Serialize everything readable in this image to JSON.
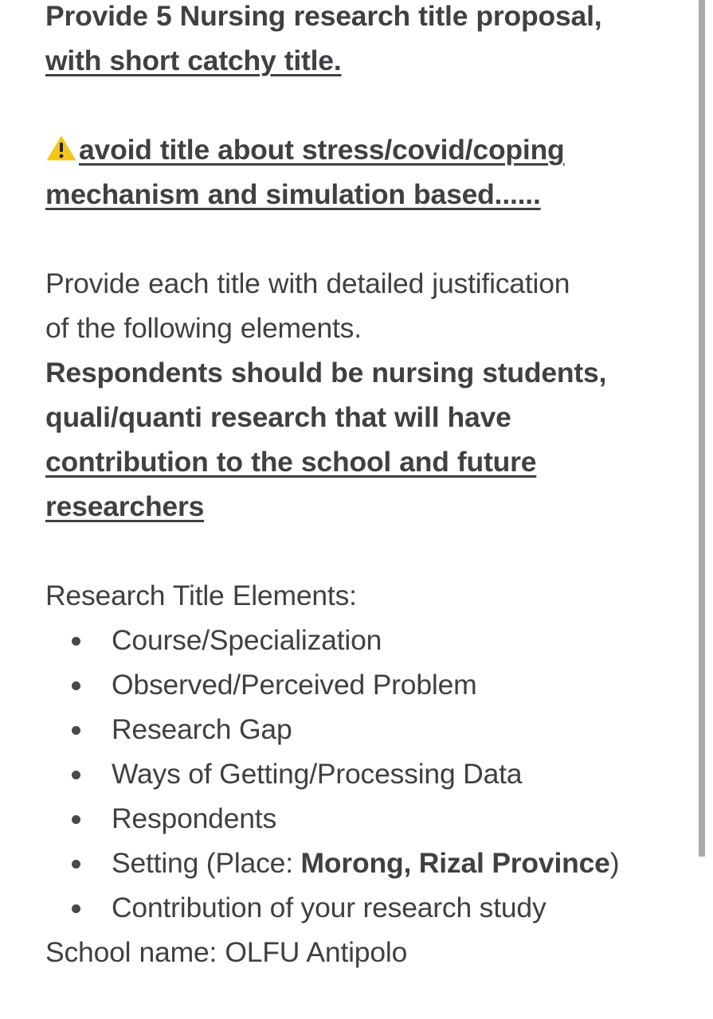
{
  "document": {
    "blocks": [
      {
        "id": "b1",
        "line1": "Provide 5 Nursing research title proposal,",
        "line2": "with short catchy title."
      },
      {
        "id": "b2",
        "icon": "warning-triangle-icon",
        "line1": "avoid title about stress/covid/coping",
        "line2": "mechanism and simulation based......"
      },
      {
        "id": "b3",
        "line1": "Provide each title with detailed justification",
        "line2": "of the following elements."
      },
      {
        "id": "b4",
        "line1": "Respondents should be nursing students,",
        "line2": "quali/quanti research that will have",
        "line3": "contribution to the school and future",
        "line4": "researchers"
      }
    ],
    "elements_heading": "Research Title Elements:",
    "elements": [
      {
        "text": "Course/Specialization"
      },
      {
        "text": "Observed/Perceived Problem"
      },
      {
        "text": "Research Gap"
      },
      {
        "text": "Ways of Getting/Processing Data"
      },
      {
        "text": "Respondents"
      },
      {
        "prefix": "Setting (Place: ",
        "emphasis": "Morong, Rizal Province",
        "suffix": ")"
      },
      {
        "text": "Contribution of your research study"
      }
    ],
    "school_line": "School name: OLFU Antipolo"
  },
  "colors": {
    "text": "#3f4043",
    "warning_triangle": "#F5C518",
    "warning_mark": "#262626",
    "bullet": "#49494c",
    "scrollbar_thumb": "#a9a9a9",
    "background": "#ffffff"
  },
  "scrollbar": {
    "orientation": "vertical",
    "thumb_position_percent": 0,
    "thumb_size_percent": 84
  }
}
